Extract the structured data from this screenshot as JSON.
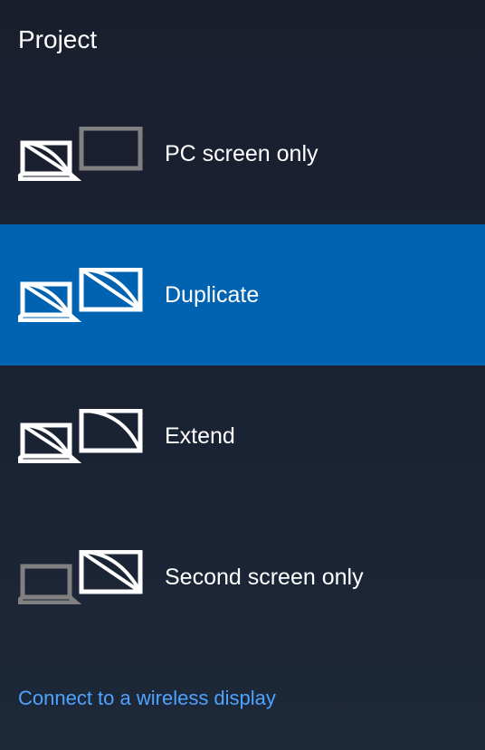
{
  "title": "Project",
  "options": [
    {
      "label": "PC screen only"
    },
    {
      "label": "Duplicate"
    },
    {
      "label": "Extend"
    },
    {
      "label": "Second screen only"
    }
  ],
  "link": "Connect to a wireless display"
}
